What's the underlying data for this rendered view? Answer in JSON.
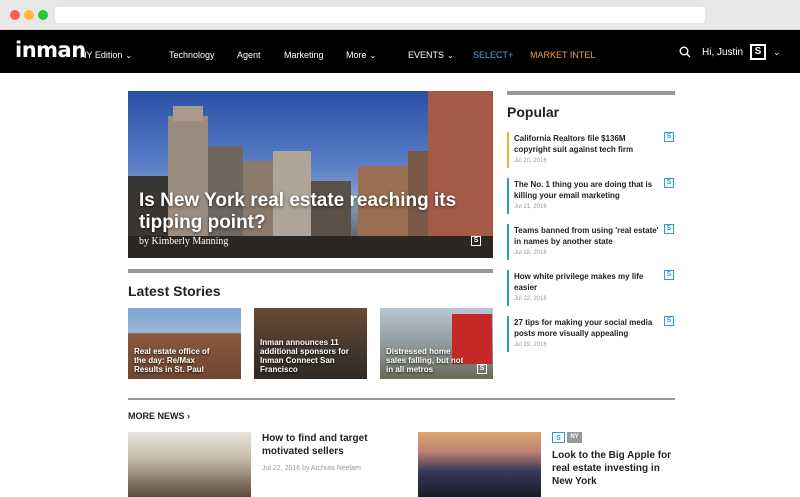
{
  "nav": {
    "logo": "inman",
    "edition": "NY Edition",
    "items": [
      {
        "label": "Technology"
      },
      {
        "label": "Agent"
      },
      {
        "label": "Marketing"
      },
      {
        "label": "More"
      },
      {
        "label": "EVENTS"
      },
      {
        "label": "SELECT+"
      },
      {
        "label": "MARKET INTEL"
      }
    ],
    "greeting": "Hi, Justin",
    "badge": "S"
  },
  "hero": {
    "title": "Is New York real estate reaching its tipping point?",
    "byline": "by Kimberly Manning",
    "badge": "S"
  },
  "latest": {
    "heading": "Latest Stories",
    "stories": [
      {
        "label": "Real estate office of the day: Re/Max Results in St. Paul"
      },
      {
        "label": "Inman announces 11 additional sponsors for Inman Connect San Francisco"
      },
      {
        "label": "Distressed home sales falling, but not in all metros",
        "badge": "S"
      }
    ]
  },
  "popular": {
    "heading": "Popular",
    "items": [
      {
        "title": "California Realtors file $136M copyright suit against tech firm",
        "date": "Jul 20, 2016",
        "badge": "S",
        "color": "#e8b62c"
      },
      {
        "title": "The No. 1 thing you are doing that is killing your email marketing",
        "date": "Jul 21, 2016",
        "badge": "S",
        "color": "#2a9dd3"
      },
      {
        "title": "Teams banned from using 'real estate' in names by another state",
        "date": "Jul 18, 2016",
        "badge": "S",
        "color": "#2a9dd3"
      },
      {
        "title": "How white privilege makes my life easier",
        "date": "Jul 22, 2016",
        "badge": "S",
        "color": "#2a9dd3"
      },
      {
        "title": "27 tips for making your social media posts more visually appealing",
        "date": "Jul 19, 2016",
        "badge": "S",
        "color": "#2a9dd3"
      }
    ]
  },
  "more_news": {
    "heading": "MORE NEWS",
    "left": {
      "title": "How to find and target motivated sellers",
      "meta": "Jul 22, 2016 by Atchuta Neelam"
    },
    "right": {
      "title": "Look to the Big Apple for real estate investing in New York",
      "tags": [
        "S",
        "NY"
      ]
    }
  }
}
